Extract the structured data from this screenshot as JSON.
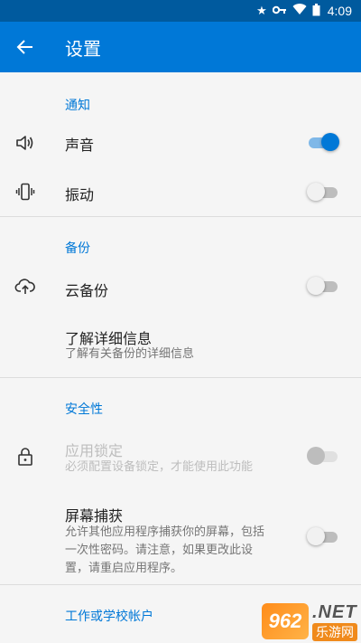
{
  "status_bar": {
    "time": "4:09",
    "icons": [
      "star-icon",
      "key-icon",
      "wifi-icon",
      "battery-icon"
    ]
  },
  "app_bar": {
    "title": "设置",
    "back_icon": "arrow-back-icon",
    "color": "#0078d7"
  },
  "sections": {
    "notifications": {
      "header": "通知",
      "sound": {
        "title": "声音",
        "icon": "speaker-icon",
        "enabled": true
      },
      "vibrate": {
        "title": "振动",
        "icon": "vibrate-phone-icon",
        "enabled": false
      }
    },
    "backup": {
      "header": "备份",
      "cloud_backup": {
        "title": "云备份",
        "icon": "cloud-upload-icon",
        "enabled": false
      },
      "learn_more": {
        "title": "了解详细信息",
        "subtitle": "了解有关备份的详细信息"
      }
    },
    "security": {
      "header": "安全性",
      "app_lock": {
        "title": "应用锁定",
        "subtitle": "必须配置设备锁定，才能使用此功能",
        "icon": "lock-icon",
        "enabled": false,
        "disabled": true
      },
      "screen_capture": {
        "title": "屏幕捕获",
        "subtitle_line1": "允许其他应用程序捕获你的屏幕，包括",
        "subtitle_line2": "一次性密码。请注意，如果更改此设",
        "subtitle_line3": "置，请重启应用程序。",
        "enabled": false
      }
    },
    "work_school": {
      "header": "工作或学校帐户"
    }
  },
  "watermark": {
    "logo_text": "962",
    "net_text": ".NET",
    "cn_text": "乐游网"
  },
  "colors": {
    "accent": "#0078d7",
    "status_bar": "#005a9e",
    "background": "#f5f5f5"
  }
}
